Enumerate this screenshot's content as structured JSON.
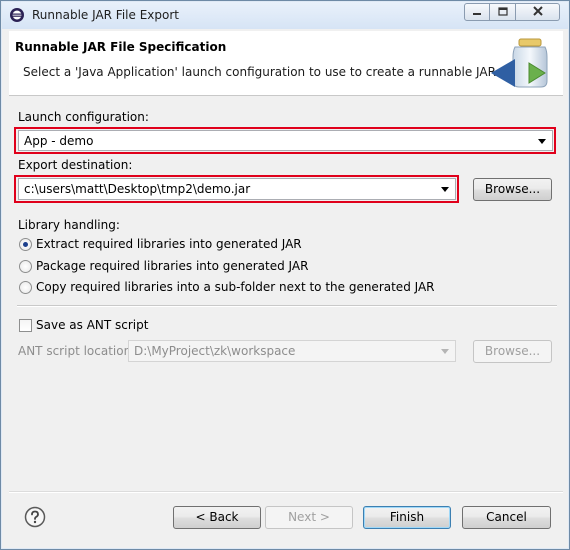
{
  "window": {
    "title": "Runnable JAR File Export"
  },
  "header": {
    "title": "Runnable JAR File Specification",
    "description": "Select a 'Java Application' launch configuration to use to create a runnable JAR."
  },
  "launch": {
    "label": "Launch configuration:",
    "value": "App - demo"
  },
  "export": {
    "label": "Export destination:",
    "value": "c:\\users\\matt\\Desktop\\tmp2\\demo.jar",
    "browse_label": "Browse..."
  },
  "library": {
    "label": "Library handling:",
    "options": [
      {
        "label": "Extract required libraries into generated JAR",
        "selected": true
      },
      {
        "label": "Package required libraries into generated JAR",
        "selected": false
      },
      {
        "label": "Copy required libraries into a sub-folder next to the generated JAR",
        "selected": false
      }
    ]
  },
  "ant": {
    "checkbox_label": "Save as ANT script",
    "checked": false,
    "location_label": "ANT script location:",
    "location_value": "D:\\MyProject\\zk\\workspace",
    "browse_label": "Browse..."
  },
  "footer": {
    "back_label": "< Back",
    "next_label": "Next >",
    "finish_label": "Finish",
    "cancel_label": "Cancel"
  },
  "colors": {
    "highlight": "#e0001b",
    "window_border": "#6e8aa6"
  },
  "icons": [
    "eclipse-icon",
    "minimize-icon",
    "maximize-icon",
    "close-icon",
    "jar-wizard-icon",
    "help-icon"
  ]
}
